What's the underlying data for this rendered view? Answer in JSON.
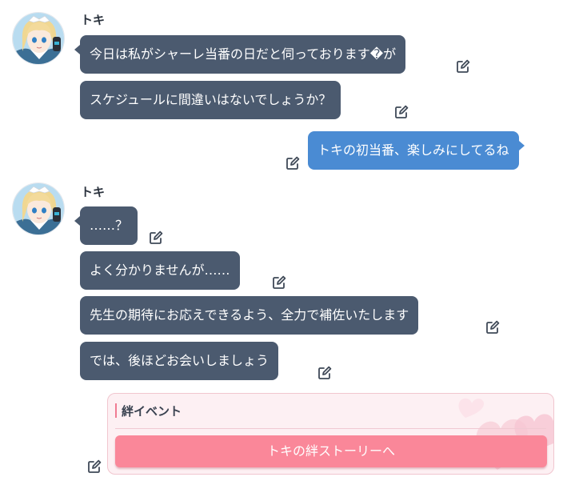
{
  "chat": {
    "speaker_name": "トキ",
    "groups": [
      {
        "speaker": "トキ",
        "messages": [
          "今日は私がシャーレ当番の日だと伺っております�が",
          "スケジュールに間違いはないでしょうか？"
        ]
      },
      {
        "speaker": "sensei",
        "messages": [
          "トキの初当番、楽しみにしてるね"
        ]
      },
      {
        "speaker": "トキ",
        "messages": [
          "……？",
          "よく分かりませんが……",
          "先生の期待にお応えできるよう、全力で補佐いたします",
          "では、後ほどお会いしましょう"
        ]
      }
    ]
  },
  "bond_event": {
    "title": "絆イベント",
    "button_label": "トキの絆ストーリーへ"
  },
  "colors": {
    "student_bubble": "#4b5a6f",
    "sensei_bubble": "#4a8bd3",
    "bond_button": "#fa8799",
    "bond_card_bg": "#fdf0f3"
  },
  "icons": {
    "edit": "edit-icon",
    "avatar": "toki-avatar"
  }
}
